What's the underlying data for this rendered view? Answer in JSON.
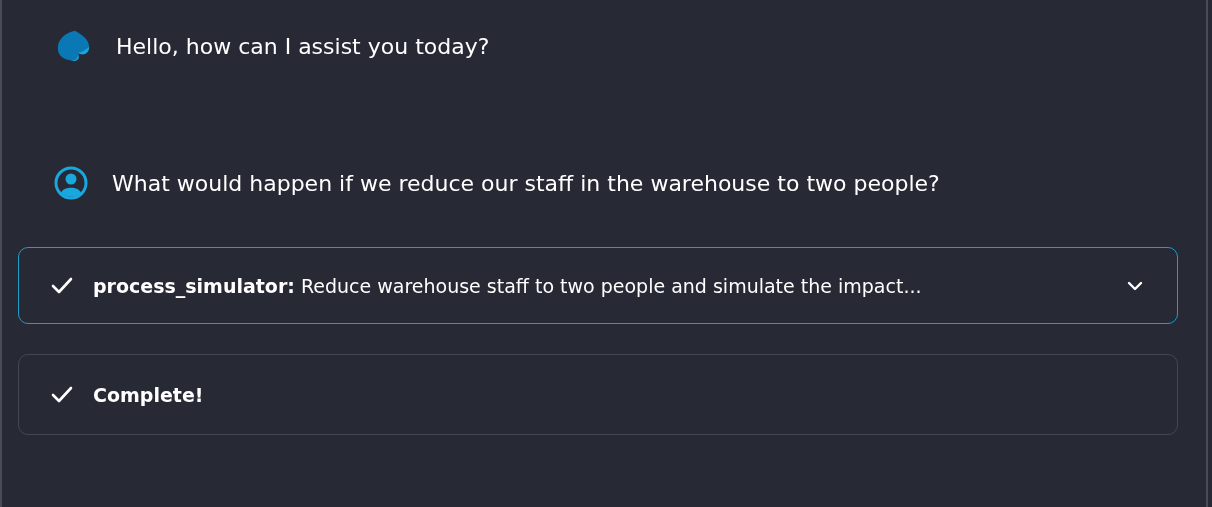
{
  "messages": [
    {
      "kind": "assistant",
      "text": "Hello, how can I assist you today?"
    },
    {
      "kind": "user",
      "text": "What would happen if we reduce our staff in the warehouse to two people?"
    }
  ],
  "steps": [
    {
      "done": true,
      "focused": true,
      "expandable": true,
      "bold": false,
      "text": "**process_simulator:** Reduce warehouse staff to two people and simulate the impact..."
    },
    {
      "done": true,
      "focused": false,
      "expandable": false,
      "text": "Complete!",
      "bold": true
    }
  ]
}
